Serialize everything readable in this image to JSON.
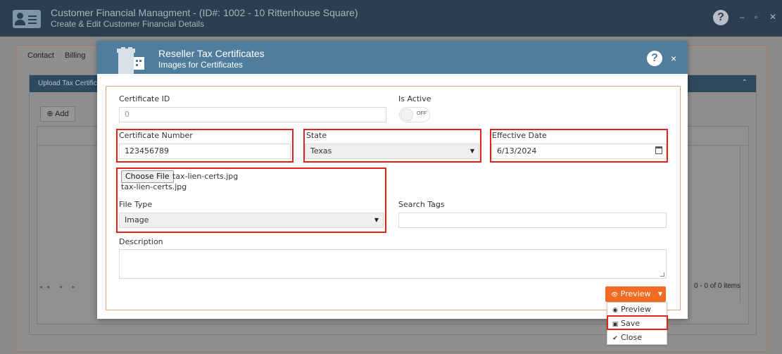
{
  "app": {
    "title": "Customer Financial Managment - (ID#: 1002 - 10 Rittenhouse Square)",
    "subtitle": "Create & Edit Customer Financial Details",
    "help": "?",
    "minimize": "–",
    "maximize": "▫",
    "close": "✕"
  },
  "background": {
    "tabs": [
      "Contact",
      "Billing"
    ],
    "panel_title": "Upload Tax Certific",
    "add_label": "Add",
    "add_icon": "plus-circle-icon",
    "pager_info": "0 - 0 of 0 items",
    "pager_nav": "◂◂ ◂ ▸"
  },
  "modal": {
    "title": "Reseller Tax Certificates",
    "subtitle": "Images for Certificates",
    "help": "?",
    "close": "×",
    "fields": {
      "certificate_id_label": "Certificate ID",
      "certificate_id_value": "0",
      "is_active_label": "Is Active",
      "is_active_toggle_text": "OFF",
      "certificate_number_label": "Certificate Number",
      "certificate_number_value": "123456789",
      "state_label": "State",
      "state_value": "Texas",
      "effective_date_label": "Effective Date",
      "effective_date_value": "6/13/2024",
      "choose_file_label": "Choose File",
      "file_name_inline": "tax-lien-certs.jpg",
      "file_name_below": "tax-lien-certs.jpg",
      "file_type_label": "File Type",
      "file_type_value": "Image",
      "search_tags_label": "Search Tags",
      "search_tags_value": "",
      "description_label": "Description",
      "description_value": ""
    },
    "actions": {
      "preview_label": "Preview",
      "dropdown_items": [
        {
          "label": "Preview",
          "icon": "eye-icon"
        },
        {
          "label": "Save",
          "icon": "floppy-disk-icon"
        },
        {
          "label": "Close",
          "icon": "check-circle-icon"
        }
      ]
    }
  },
  "colors": {
    "header_bg": "#2b3f50",
    "modal_header_bg": "#4f7d9b",
    "accent_orange": "#f26b22",
    "highlight_red": "#e0231b",
    "form_border": "#f0a27b"
  }
}
